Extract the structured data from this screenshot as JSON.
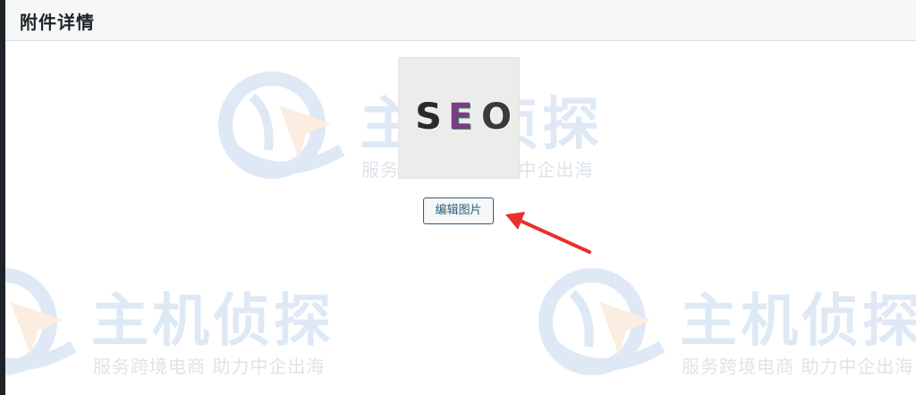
{
  "header": {
    "title": "附件详情"
  },
  "attachment": {
    "seo_letters": [
      "S",
      "E",
      "O"
    ],
    "edit_button_label": "编辑图片"
  },
  "watermark": {
    "brand": "主机侦探",
    "slogan": "服务跨境电商 助力中企出海"
  },
  "annotation": {
    "arrow_color": "#e8302c"
  },
  "colors": {
    "sidebar": "#1d2327",
    "header_bg": "#f6f7f7",
    "button_border": "#2c5d7b",
    "watermark_blue": "#6f9dd3"
  }
}
